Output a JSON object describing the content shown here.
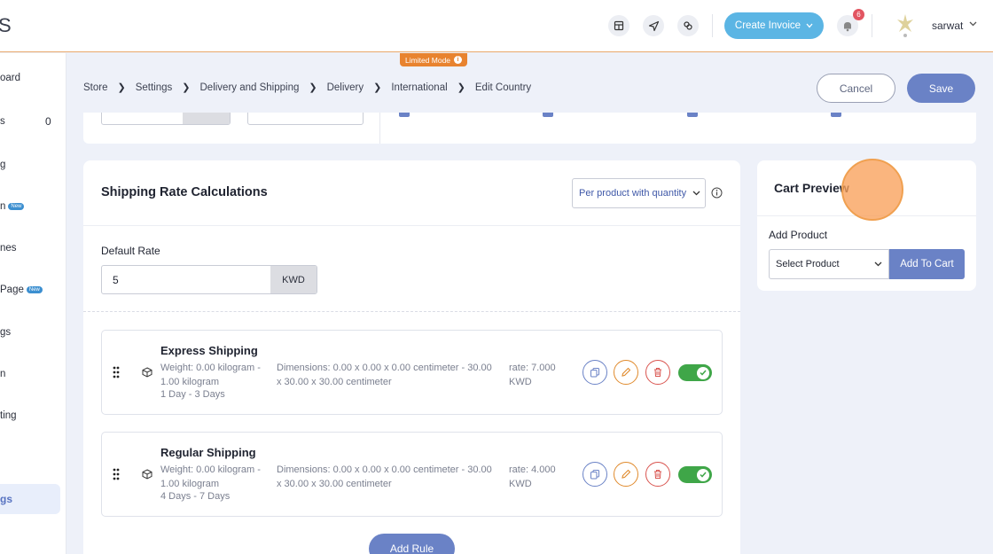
{
  "header": {
    "logo_text": "S",
    "create_invoice": "Create Invoice",
    "notifications": "6",
    "username": "sarwat"
  },
  "limited_mode": "Limited Mode",
  "sidebar": {
    "items": [
      {
        "label": "oard"
      },
      {
        "label": "s"
      },
      {
        "label": "g"
      },
      {
        "label": "n"
      },
      {
        "label": "nes"
      },
      {
        "label": "Page"
      },
      {
        "label": "gs"
      },
      {
        "label": "n"
      },
      {
        "label": "ting"
      }
    ],
    "count": "0",
    "new_badge": "New",
    "active": "gs"
  },
  "breadcrumb": [
    "Store",
    "Settings",
    "Delivery and Shipping",
    "Delivery",
    "International",
    "Edit Country"
  ],
  "actions": {
    "cancel": "Cancel",
    "save": "Save"
  },
  "shipping": {
    "title": "Shipping Rate Calculations",
    "method": "Per product with quantity",
    "default_rate_label": "Default Rate",
    "default_rate_value": "5",
    "currency": "KWD",
    "rules": [
      {
        "name": "Express Shipping",
        "weight": "Weight: 0.00 kilogram - 1.00 kilogram",
        "days": "1 Day - 3 Days",
        "dimensions": "Dimensions: 0.00 x 0.00 x 0.00 centimeter - 30.00 x 30.00 x 30.00 centimeter",
        "rate": "rate: 7.000 KWD",
        "enabled": true
      },
      {
        "name": "Regular Shipping",
        "weight": "Weight: 0.00 kilogram - 1.00 kilogram",
        "days": "4 Days - 7 Days",
        "dimensions": "Dimensions: 0.00 x 0.00 x 0.00 centimeter - 30.00 x 30.00 x 30.00 centimeter",
        "rate": "rate: 4.000 KWD",
        "enabled": true
      }
    ],
    "add_rule": "Add Rule"
  },
  "cart_preview": {
    "title": "Cart Preview",
    "add_product_label": "Add Product",
    "select_placeholder": "Select Product",
    "add_to_cart": "Add To Cart"
  },
  "colors": {
    "accent": "#6a82c6",
    "create_invoice": "#5bb5e4",
    "limited_mode": "#e8832f",
    "toggle_on": "#3fa648",
    "delete": "#d9544f",
    "edit": "#e08a2c"
  }
}
